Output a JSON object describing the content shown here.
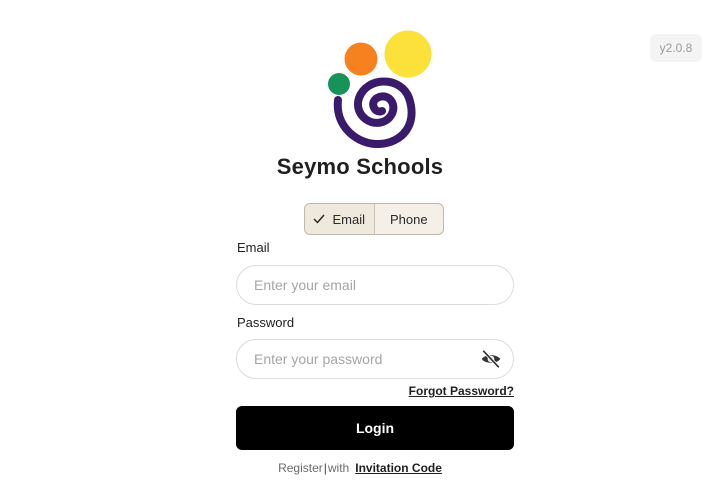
{
  "version": "y2.0.8",
  "brand": {
    "name": "Seymo Schools",
    "colors": {
      "orange": "#f7801f",
      "yellow": "#fbe13a",
      "green": "#17935a",
      "purple": "#3a1a6b"
    }
  },
  "login_mode": {
    "options": [
      "Email",
      "Phone"
    ],
    "selected": "Email"
  },
  "form": {
    "email_label": "Email",
    "email_placeholder": "Enter your email",
    "email_value": "",
    "password_label": "Password",
    "password_placeholder": "Enter your password",
    "password_value": "",
    "password_toggle_icon": "eye-slash-icon",
    "forgot_password": "Forgot Password?",
    "login_button": "Login"
  },
  "footer": {
    "register": "Register",
    "separator": "|",
    "with": "with",
    "invitation_code": "Invitation Code"
  }
}
